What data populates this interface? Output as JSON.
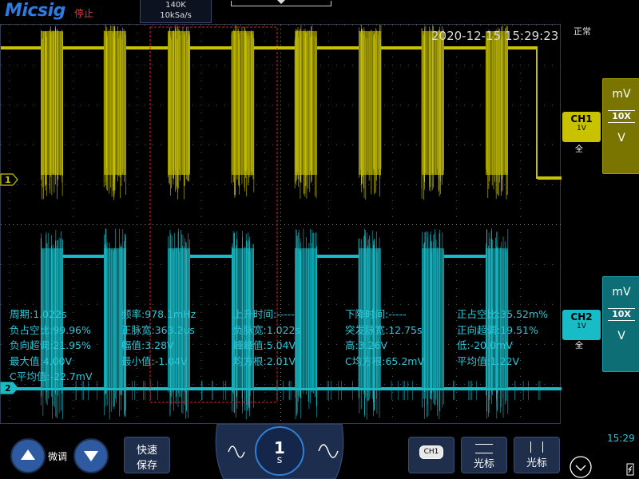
{
  "header": {
    "brand": "Micsig",
    "run_state": "停止",
    "memory_depth": "140K",
    "sample_rate": "10kSa/s",
    "timestamp": "2020-12-15 15:29:23",
    "status": "正常"
  },
  "channels": {
    "ch1": {
      "marker": "1",
      "name": "CH1",
      "scale": "1V",
      "coupling": "全",
      "color": "#c8c200",
      "probe": {
        "up": "mV",
        "ratio": "10X",
        "down": "V"
      }
    },
    "ch2": {
      "marker": "2",
      "name": "CH2",
      "scale": "1V",
      "coupling": "全",
      "color": "#17bcc6",
      "probe": {
        "up": "mV",
        "ratio": "10X",
        "down": "V"
      }
    }
  },
  "measurements": [
    [
      "周期:1.022s",
      "频率:978.1mHz",
      "上升时间:-----",
      "下降时间:-----",
      "正占空比:35.52m%"
    ],
    [
      "负占空比:99.96%",
      "正脉宽:363.2us",
      "负脉宽:1.022s",
      "突发脉宽:12.75s",
      "正向超调:19.51%"
    ],
    [
      "负向超调:21.95%",
      "幅值:3.28V",
      "峰峰值:5.04V",
      "高:3.26V",
      "低:-20.0mV"
    ],
    [
      "最大值:4.00V",
      "最小值:-1.04V",
      "均方根:2.01V",
      "C均方根:65.2mV",
      "平均值:1.22V"
    ],
    [
      "C平均值:-22.7mV"
    ]
  ],
  "bottom": {
    "fine_label": "微调",
    "save_label_1": "快速",
    "save_label_2": "保存",
    "timebase_value": "1",
    "timebase_unit": "s",
    "ch_select": "CH1",
    "cursor1_label": "光标",
    "cursor2_label": "光标",
    "clock": "15:29"
  },
  "colors": {
    "accent": "#2d5aa0",
    "ch1": "#c8c200",
    "ch2": "#17bcc6",
    "bg": "#000000"
  }
}
